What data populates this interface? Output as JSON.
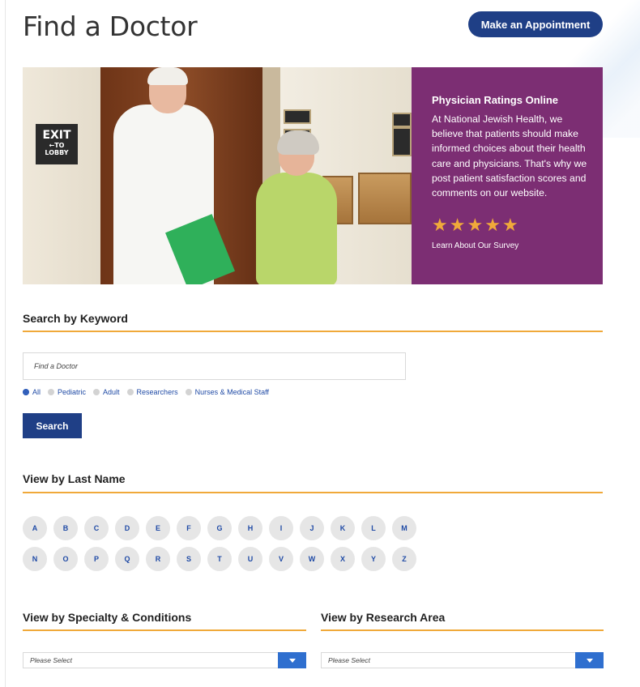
{
  "page": {
    "title": "Find a Doctor"
  },
  "header": {
    "appointment_button": "Make an Appointment"
  },
  "hero": {
    "exit_sign": {
      "line1": "EXIT",
      "line2": "←TO",
      "line3": "LOBBY"
    },
    "ratings": {
      "title": "Physician Ratings Online",
      "body": "At National Jewish Health, we believe that patients should make informed choices about their health care and physicians. That's why we post patient satisfaction scores and comments on our website.",
      "stars": 5,
      "star_glyph": "★",
      "link": "Learn About Our Survey",
      "colors": {
        "panel": "#7c2e73",
        "star": "#f0a93a"
      }
    }
  },
  "keyword_search": {
    "heading": "Search by Keyword",
    "placeholder": "Find a Doctor",
    "filters": [
      {
        "label": "All",
        "selected": true
      },
      {
        "label": "Pediatric",
        "selected": false
      },
      {
        "label": "Adult",
        "selected": false
      },
      {
        "label": "Researchers",
        "selected": false
      },
      {
        "label": "Nurses & Medical Staff",
        "selected": false
      }
    ],
    "search_button": "Search"
  },
  "last_name": {
    "heading": "View by Last Name",
    "row1": [
      "A",
      "B",
      "C",
      "D",
      "E",
      "F",
      "G",
      "H",
      "I",
      "J",
      "K",
      "L",
      "M"
    ],
    "row2": [
      "N",
      "O",
      "P",
      "Q",
      "R",
      "S",
      "T",
      "U",
      "V",
      "W",
      "X",
      "Y",
      "Z"
    ]
  },
  "specialty": {
    "heading": "View by Specialty & Conditions",
    "selected": "Please Select"
  },
  "research": {
    "heading": "View by Research Area",
    "selected": "Please Select"
  },
  "colors": {
    "brand_blue": "#1f3f86",
    "accent_orange": "#f0a93a",
    "link_blue": "#1f4aa5"
  }
}
